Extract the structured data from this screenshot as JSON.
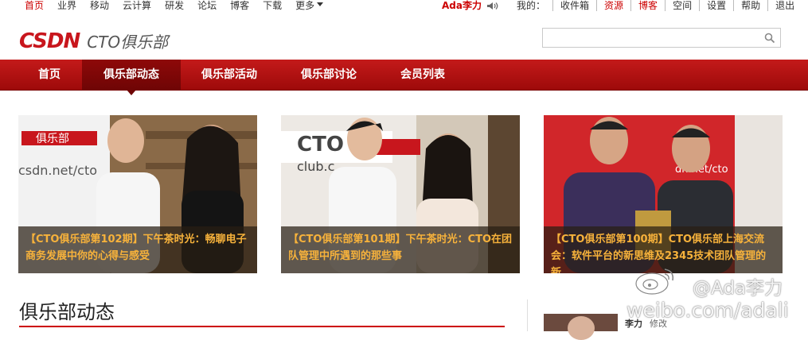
{
  "topbar": {
    "nav": [
      "首页",
      "业界",
      "移动",
      "云计算",
      "研发",
      "论坛",
      "博客",
      "下载",
      "更多"
    ],
    "active_index": 0,
    "user": "Ada李力",
    "links": [
      {
        "label": "我的：",
        "red": false
      },
      {
        "label": "收件箱",
        "red": false
      },
      {
        "label": "资源",
        "red": true
      },
      {
        "label": "博客",
        "red": true
      },
      {
        "label": "空间",
        "red": false
      },
      {
        "label": "设置",
        "red": false
      },
      {
        "label": "帮助",
        "red": false
      },
      {
        "label": "退出",
        "red": false
      }
    ]
  },
  "header": {
    "logo_mark": "CSDN",
    "logo_sub": "CTO俱乐部",
    "search_value": ""
  },
  "mainnav": {
    "items": [
      "首页",
      "俱乐部动态",
      "俱乐部活动",
      "俱乐部讨论",
      "会员列表"
    ],
    "active_index": 1
  },
  "slides": [
    {
      "caption": "【CTO俱乐部第102期】下午茶时光：畅聊电子商务发展中你的心得与感受"
    },
    {
      "caption": "【CTO俱乐部第101期】下午茶时光：CTO在团队管理中所遇到的那些事"
    },
    {
      "caption": "【CTO俱乐部第100期】CTO俱乐部上海交流会：软件平台的新思维及2345技术团队管理的新"
    }
  ],
  "section": {
    "title": "俱乐部动态"
  },
  "member": {
    "name": "李力",
    "action": "修改"
  },
  "watermark": {
    "handle": "@Ada李力",
    "url": "weibo.com/adali"
  },
  "colors": {
    "brand_red": "#c8161d",
    "caption_gold": "#f7b23b"
  }
}
